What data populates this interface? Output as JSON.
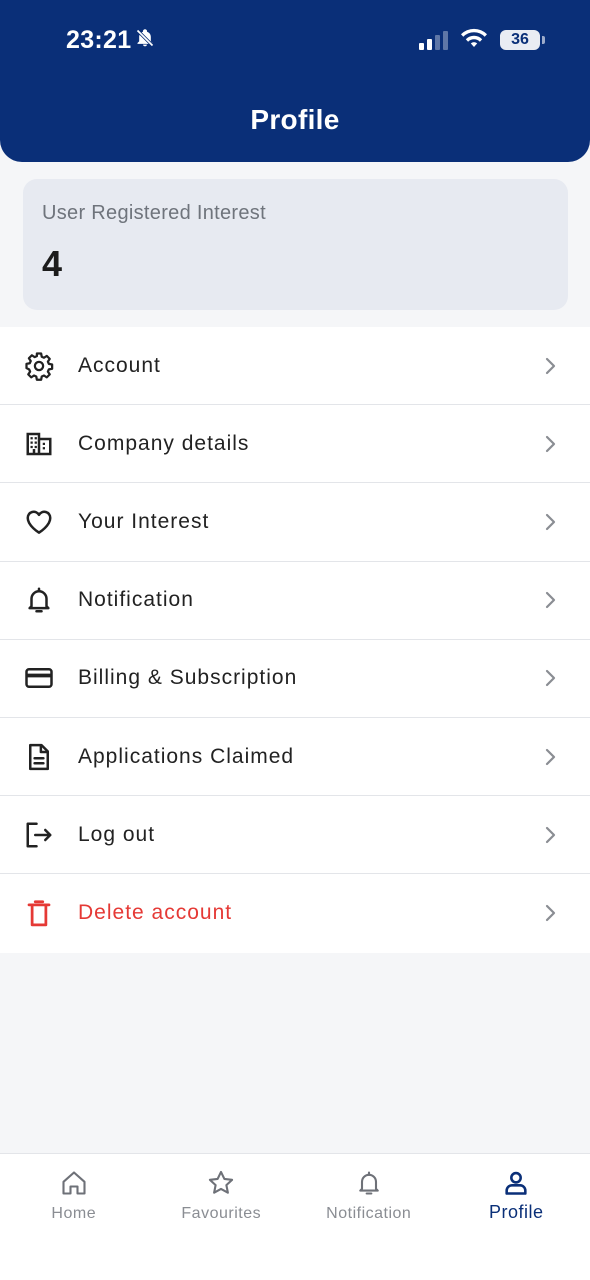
{
  "status_bar": {
    "time": "23:21",
    "battery": "36"
  },
  "header": {
    "title": "Profile",
    "background_color": "#0a2f78"
  },
  "interest_card": {
    "label": "User Registered Interest",
    "value": "4"
  },
  "menu": {
    "items": [
      {
        "label": "Account",
        "icon": "gear-icon"
      },
      {
        "label": "Company details",
        "icon": "building-icon"
      },
      {
        "label": "Your Interest",
        "icon": "heart-icon"
      },
      {
        "label": "Notification",
        "icon": "bell-icon"
      },
      {
        "label": "Billing & Subscription",
        "icon": "credit-card-icon"
      },
      {
        "label": "Applications Claimed",
        "icon": "document-icon"
      },
      {
        "label": "Log out",
        "icon": "logout-icon"
      },
      {
        "label": "Delete account",
        "icon": "trash-icon",
        "color": "#e53935"
      }
    ]
  },
  "bottom_nav": {
    "items": [
      {
        "label": "Home",
        "icon": "home-icon"
      },
      {
        "label": "Favourites",
        "icon": "star-icon"
      },
      {
        "label": "Notification",
        "icon": "bell-icon"
      },
      {
        "label": "Profile",
        "icon": "person-icon",
        "active": true
      }
    ],
    "active_color": "#0a2f78"
  }
}
